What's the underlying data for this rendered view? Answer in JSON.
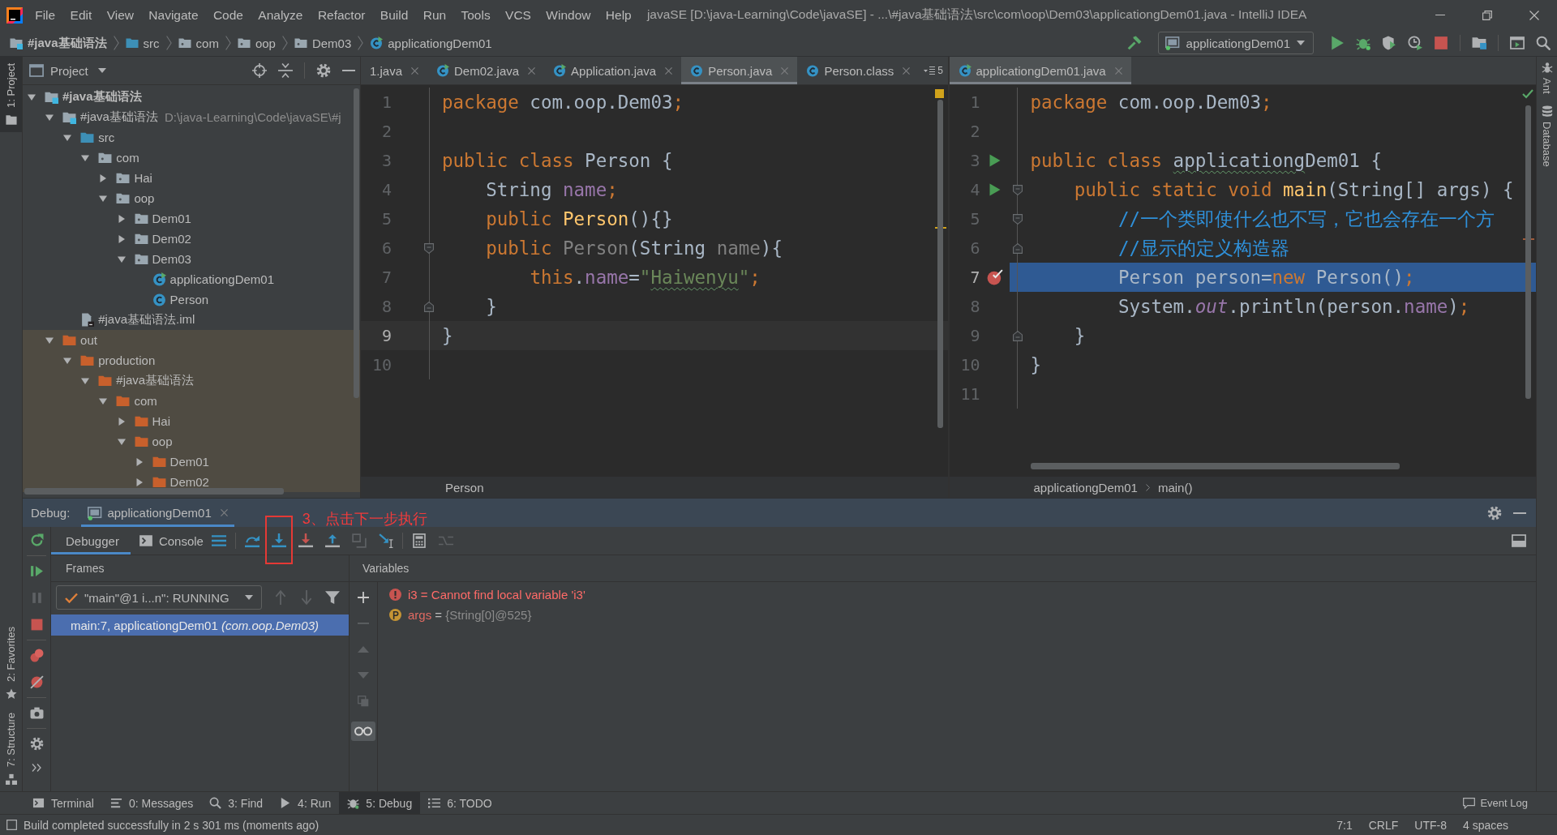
{
  "menu_bar": {
    "items": [
      "File",
      "Edit",
      "View",
      "Navigate",
      "Code",
      "Analyze",
      "Refactor",
      "Build",
      "Run",
      "Tools",
      "VCS",
      "Window",
      "Help"
    ],
    "title": "javaSE [D:\\java-Learning\\Code\\javaSE] - ...\\#java基础语法\\src\\com\\oop\\Dem03\\applicationgDem01.java - IntelliJ IDEA"
  },
  "nav_bar": {
    "breadcrumbs": [
      {
        "label": "#java基础语法",
        "kind": "project"
      },
      {
        "label": "src",
        "kind": "source-folder"
      },
      {
        "label": "com",
        "kind": "package"
      },
      {
        "label": "oop",
        "kind": "package"
      },
      {
        "label": "Dem03",
        "kind": "package"
      },
      {
        "label": "applicationgDem01",
        "kind": "runnable-class"
      }
    ],
    "run_config": "applicationgDem01"
  },
  "left_strip": {
    "top": [
      {
        "label": "1: Project",
        "selected": true
      }
    ],
    "bottom": [
      {
        "label": "2: Favorites",
        "kind": "favorites",
        "selected": false
      },
      {
        "label": "7: Structure",
        "kind": "structure",
        "selected": false
      }
    ]
  },
  "right_strip": [
    {
      "label": "Ant",
      "kind": "ant"
    },
    {
      "label": "Database",
      "kind": "database"
    }
  ],
  "project": {
    "title": "Project",
    "tree": [
      {
        "label": "#java基础语法",
        "kind": "project",
        "expanded": true,
        "children": [
          {
            "label": "#java基础语法",
            "hint": "D:\\java-Learning\\Code\\javaSE\\#j",
            "kind": "module",
            "expanded": true,
            "children": [
              {
                "label": "src",
                "kind": "source-folder",
                "expanded": true,
                "children": [
                  {
                    "label": "com",
                    "kind": "package",
                    "expanded": true,
                    "children": [
                      {
                        "label": "Hai",
                        "kind": "package",
                        "expanded": false
                      },
                      {
                        "label": "oop",
                        "kind": "package",
                        "expanded": true,
                        "children": [
                          {
                            "label": "Dem01",
                            "kind": "package",
                            "expanded": false
                          },
                          {
                            "label": "Dem02",
                            "kind": "package",
                            "expanded": false
                          },
                          {
                            "label": "Dem03",
                            "kind": "package",
                            "expanded": true,
                            "children": [
                              {
                                "label": "applicationgDem01",
                                "kind": "runnable-class"
                              },
                              {
                                "label": "Person",
                                "kind": "class"
                              }
                            ]
                          }
                        ]
                      }
                    ]
                  }
                ]
              },
              {
                "label": "#java基础语法.iml",
                "kind": "iml"
              }
            ]
          },
          {
            "label": "out",
            "kind": "excluded-folder",
            "expanded": true,
            "children": [
              {
                "label": "production",
                "kind": "excluded-folder",
                "expanded": true,
                "children": [
                  {
                    "label": "#java基础语法",
                    "kind": "excluded-folder",
                    "expanded": true,
                    "children": [
                      {
                        "label": "com",
                        "kind": "excluded-folder",
                        "expanded": true,
                        "children": [
                          {
                            "label": "Hai",
                            "kind": "excluded-folder",
                            "expanded": false
                          },
                          {
                            "label": "oop",
                            "kind": "excluded-folder",
                            "expanded": true,
                            "children": [
                              {
                                "label": "Dem01",
                                "kind": "excluded-folder",
                                "expanded": false
                              },
                              {
                                "label": "Dem02",
                                "kind": "excluded-folder",
                                "expanded": false
                              }
                            ]
                          }
                        ]
                      }
                    ]
                  }
                ]
              }
            ]
          }
        ]
      }
    ]
  },
  "editors": [
    {
      "tabs": [
        {
          "label": "1.java",
          "selected": false
        },
        {
          "label": "Dem02.java",
          "kind": "runnable-class",
          "selected": false
        },
        {
          "label": "Application.java",
          "kind": "runnable-class",
          "selected": false
        },
        {
          "label": "Person.java",
          "kind": "class",
          "selected": true
        },
        {
          "label": "Person.class",
          "kind": "class",
          "selected": false
        }
      ],
      "overflow": "5",
      "has_warnings": true,
      "lines": [
        {
          "number": "1",
          "kind": "normal",
          "tokens": [
            {
              "kind": "keyword",
              "text": "package"
            },
            {
              "kind": "plain",
              "text": " com.oop.Dem03"
            },
            {
              "kind": "keyword",
              "text": ";"
            }
          ]
        },
        {
          "number": "2",
          "kind": "normal"
        },
        {
          "number": "3",
          "kind": "normal",
          "tokens": [
            {
              "kind": "keyword",
              "text": "public class "
            },
            {
              "kind": "plain",
              "text": "Person {"
            }
          ]
        },
        {
          "number": "4",
          "kind": "normal",
          "tokens": [
            {
              "kind": "plain",
              "text": "    String "
            },
            {
              "kind": "field",
              "text": "name"
            },
            {
              "kind": "keyword",
              "text": ";"
            }
          ]
        },
        {
          "number": "5",
          "kind": "normal",
          "tokens": [
            {
              "kind": "keyword",
              "text": "    public "
            },
            {
              "kind": "method",
              "text": "Person"
            },
            {
              "kind": "plain",
              "text": "(){}"
            }
          ]
        },
        {
          "number": "6",
          "kind": "normal",
          "markers": [
            {
              "kind": "fold-start"
            }
          ],
          "tokens": [
            {
              "kind": "keyword",
              "text": "    public "
            },
            {
              "kind": "unused",
              "text": "Person"
            },
            {
              "kind": "plain",
              "text": "(String "
            },
            {
              "kind": "unused",
              "text": "name"
            },
            {
              "kind": "plain",
              "text": "){"
            }
          ]
        },
        {
          "number": "7",
          "kind": "normal",
          "tokens": [
            {
              "kind": "keyword",
              "text": "        this"
            },
            {
              "kind": "plain",
              "text": "."
            },
            {
              "kind": "field",
              "text": "name"
            },
            {
              "kind": "plain",
              "text": "="
            },
            {
              "kind": "string",
              "text": "\""
            },
            {
              "kind": "string",
              "text": "Haiwenyu",
              "typo": true
            },
            {
              "kind": "string",
              "text": "\""
            },
            {
              "kind": "keyword",
              "text": ";"
            }
          ]
        },
        {
          "number": "8",
          "kind": "normal",
          "markers": [
            {
              "kind": "fold-end"
            }
          ],
          "tokens": [
            {
              "kind": "plain",
              "text": "    }"
            }
          ]
        },
        {
          "number": "9",
          "kind": "current",
          "tokens": [
            {
              "kind": "plain",
              "text": "}"
            }
          ]
        },
        {
          "number": "10",
          "kind": "normal"
        }
      ],
      "breadcrumbs": [
        "Person"
      ]
    },
    {
      "tabs": [
        {
          "label": "applicationgDem01.java",
          "kind": "runnable-class",
          "selected": true
        }
      ],
      "has_warnings": false,
      "lines": [
        {
          "number": "1",
          "kind": "normal",
          "tokens": [
            {
              "kind": "keyword",
              "text": "package"
            },
            {
              "kind": "plain",
              "text": " com.oop.Dem03"
            },
            {
              "kind": "keyword",
              "text": ";"
            }
          ]
        },
        {
          "number": "2",
          "kind": "normal"
        },
        {
          "number": "3",
          "kind": "normal",
          "markers": [
            {
              "kind": "run"
            }
          ],
          "tokens": [
            {
              "kind": "keyword",
              "text": "public class "
            },
            {
              "kind": "plain",
              "text": "applicationg",
              "typo": true
            },
            {
              "kind": "plain",
              "text": "Dem01 {"
            }
          ]
        },
        {
          "number": "4",
          "kind": "normal",
          "markers": [
            {
              "kind": "run"
            },
            {
              "kind": "fold-start"
            }
          ],
          "tokens": [
            {
              "kind": "keyword",
              "text": "    public static void "
            },
            {
              "kind": "method",
              "text": "main"
            },
            {
              "kind": "plain",
              "text": "(String[] args) {"
            }
          ]
        },
        {
          "number": "5",
          "kind": "normal",
          "markers": [
            {
              "kind": "fold-start"
            }
          ],
          "tokens": [
            {
              "kind": "comment",
              "text": "        //一个类即使什么也不写，它也会存在一个方"
            }
          ]
        },
        {
          "number": "6",
          "kind": "normal",
          "markers": [
            {
              "kind": "fold-end"
            }
          ],
          "tokens": [
            {
              "kind": "comment",
              "text": "        //显示的定义构造器"
            }
          ]
        },
        {
          "number": "7",
          "kind": "execution",
          "markers": [
            {
              "kind": "breakpoint"
            }
          ],
          "tokens": [
            {
              "kind": "plain",
              "text": "        Person person="
            },
            {
              "kind": "keyword",
              "text": "new"
            },
            {
              "kind": "plain",
              "text": " Person()"
            },
            {
              "kind": "keyword",
              "text": ";"
            }
          ]
        },
        {
          "number": "8",
          "kind": "normal",
          "tokens": [
            {
              "kind": "plain",
              "text": "        System."
            },
            {
              "kind": "static",
              "text": "out"
            },
            {
              "kind": "plain",
              "text": ".println(person."
            },
            {
              "kind": "field",
              "text": "name"
            },
            {
              "kind": "plain",
              "text": ")"
            },
            {
              "kind": "keyword",
              "text": ";"
            }
          ]
        },
        {
          "number": "9",
          "kind": "normal",
          "markers": [
            {
              "kind": "fold-end"
            }
          ],
          "tokens": [
            {
              "kind": "plain",
              "text": "    }"
            }
          ]
        },
        {
          "number": "10",
          "kind": "normal",
          "tokens": [
            {
              "kind": "plain",
              "text": "}"
            }
          ]
        },
        {
          "number": "11",
          "kind": "normal"
        }
      ],
      "breadcrumbs": [
        "applicationgDem01",
        "main()"
      ]
    }
  ],
  "debug": {
    "title": "Debug:",
    "sessions": [
      {
        "label": "applicationgDem01",
        "selected": true
      }
    ],
    "annotation": "3、点击下一步执行",
    "tabs": [
      {
        "label": "Debugger",
        "selected": true
      },
      {
        "label": "Console",
        "kind": "console",
        "selected": false
      }
    ],
    "frames": {
      "title": "Frames",
      "thread": "\"main\"@1 i...n\": RUNNING",
      "items": [
        {
          "text": "main:7, applicationgDem01 *(com.oop.Dem03)*",
          "selected": true
        }
      ]
    },
    "variables": {
      "title": "Variables",
      "items": [
        {
          "kind": "error",
          "name": "i3",
          "separator": "=",
          "value": "Cannot find local variable 'i3'"
        },
        {
          "kind": "param",
          "name": "args",
          "separator": "=",
          "value": "{String[0]@525}"
        }
      ]
    }
  },
  "tool_tabs": [
    {
      "label": "Terminal",
      "kind": "terminal",
      "selected": false
    },
    {
      "label": "0: Messages",
      "kind": "messages",
      "selected": false
    },
    {
      "label": "3: Find",
      "kind": "find",
      "selected": false
    },
    {
      "label": "4: Run",
      "kind": "run",
      "selected": false
    },
    {
      "label": "5: Debug",
      "kind": "debug",
      "selected": true
    },
    {
      "label": "6: TODO",
      "kind": "todo",
      "selected": false
    }
  ],
  "event_log": "Event Log",
  "status_bar": {
    "message": "Build completed successfully in 2 s 301 ms (moments ago)",
    "items": [
      "7:1",
      "CRLF",
      "UTF-8",
      "4 spaces"
    ]
  }
}
